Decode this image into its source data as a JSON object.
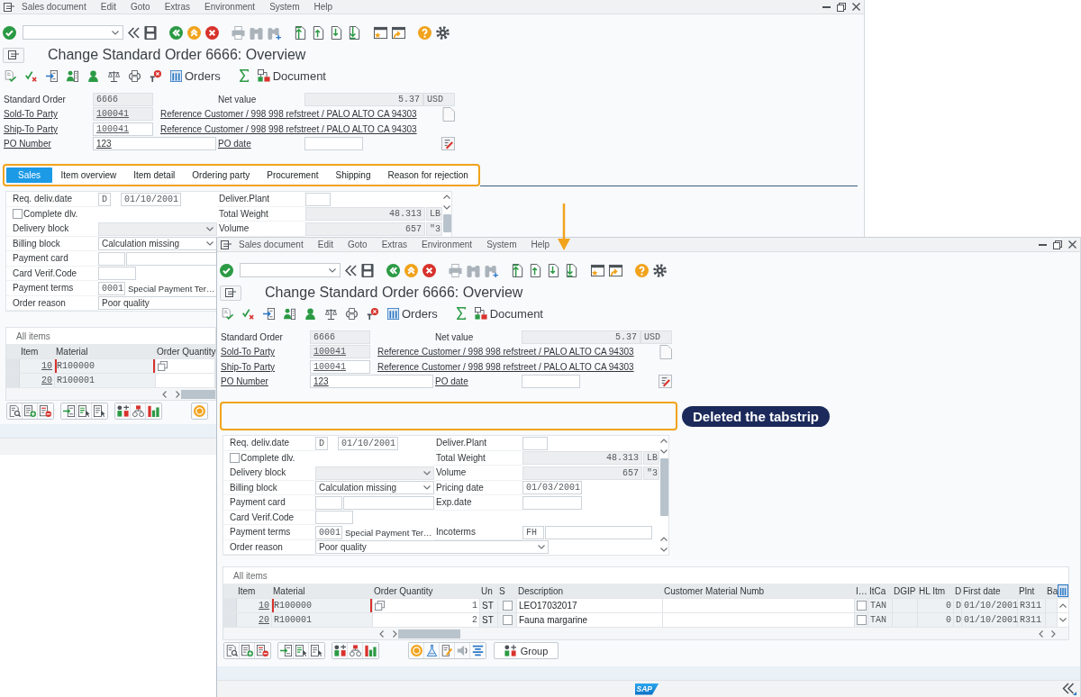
{
  "windows": [
    {
      "menu_bar": [
        "Sales document",
        "Edit",
        "Goto",
        "Extras",
        "Environment",
        "System",
        "Help"
      ],
      "title": "Change Standard Order 6666: Overview",
      "app_toolbar": {
        "orders_button": "Orders",
        "document_button": "Document"
      },
      "header": {
        "standard_order": {
          "label": "Standard Order",
          "link": false,
          "value": "6666",
          "editable": false
        },
        "net_value": {
          "label": "Net value",
          "link": false,
          "value": "5.37",
          "currency": "USD",
          "editable": false
        },
        "sold_to_party": {
          "label": "Sold-To Party",
          "link": true,
          "value": "100041",
          "editable": false,
          "description": "Reference Customer / 998 998 refstreet / PALO ALTO CA 94303"
        },
        "ship_to_party": {
          "label": "Ship-To Party",
          "link": true,
          "value": "100041",
          "editable": true,
          "description": "Reference Customer / 998 998 refstreet / PALO ALTO CA 94303"
        },
        "po_number": {
          "label": "PO Number",
          "link": true,
          "value": "123",
          "editable": true
        },
        "po_date": {
          "label": "PO date",
          "link": true,
          "editable": true
        }
      },
      "tabstrip": {
        "highlighted": true,
        "tabs": [
          {
            "label": "Sales",
            "selected": true
          },
          {
            "label": "Item overview",
            "selected": false
          },
          {
            "label": "Item detail",
            "selected": false
          },
          {
            "label": "Ordering party",
            "selected": false
          },
          {
            "label": "Procurement",
            "selected": false
          },
          {
            "label": "Shipping",
            "selected": false
          },
          {
            "label": "Reason for rejection",
            "selected": false
          }
        ]
      },
      "form": {
        "rows": [
          {
            "left": {
              "kind": "date",
              "label": "Req. deliv.date",
              "date_type": "D",
              "value": "01/10/2001"
            },
            "right": {
              "kind": "field",
              "label": "Deliver.Plant"
            }
          },
          {
            "left": {
              "kind": "checkbox",
              "label": "Complete dlv.",
              "checked": false
            },
            "right": {
              "kind": "quantity",
              "label": "Total Weight",
              "value": "48.313",
              "unit": "LB",
              "editable": false
            }
          },
          {
            "left": {
              "kind": "dropdown",
              "label": "Delivery block",
              "editable": false
            },
            "right": {
              "kind": "quantity",
              "label": "Volume",
              "value": "657",
              "unit": "\"3",
              "editable": false
            }
          },
          {
            "left": {
              "kind": "dropdown",
              "label": "Billing block",
              "value": "Calculation missing",
              "editable": true
            }
          },
          {
            "left": {
              "kind": "split",
              "label": "Payment card"
            }
          },
          {
            "left": {
              "kind": "field",
              "label": "Card Verif.Code"
            }
          },
          {
            "left": {
              "kind": "code",
              "label": "Payment terms",
              "code": "0001",
              "text": "Special Payment Ter…"
            }
          },
          {
            "left": {
              "kind": "textbox",
              "label": "Order reason",
              "value": "Poor quality"
            }
          }
        ]
      },
      "table": {
        "title": "All items",
        "columns": [
          {
            "label": "Item",
            "kind": "hotspot",
            "editable": false
          },
          {
            "label": "Material",
            "kind": "keyfield",
            "editable": false
          },
          {
            "label": "Order Quantity",
            "kind": "quantity",
            "editable": true
          }
        ],
        "rows": [
          {
            "item": "10",
            "material": "R100000",
            "focused": true
          },
          {
            "item": "20",
            "material": "R100001",
            "focused": false
          }
        ]
      }
    },
    {
      "menu_bar": [
        "Sales document",
        "Edit",
        "Goto",
        "Extras",
        "Environment",
        "System",
        "Help"
      ],
      "title": "Change Standard Order 6666: Overview",
      "app_toolbar": {
        "orders_button": "Orders",
        "document_button": "Document"
      },
      "header": {
        "standard_order": {
          "label": "Standard Order",
          "link": false,
          "value": "6666",
          "editable": false
        },
        "net_value": {
          "label": "Net value",
          "link": false,
          "value": "5.37",
          "currency": "USD",
          "editable": false
        },
        "sold_to_party": {
          "label": "Sold-To Party",
          "link": true,
          "value": "100041",
          "editable": false,
          "description": "Reference Customer / 998 998 refstreet / PALO ALTO CA 94303"
        },
        "ship_to_party": {
          "label": "Ship-To Party",
          "link": true,
          "value": "100041",
          "editable": true,
          "description": "Reference Customer / 998 998 refstreet / PALO ALTO CA 94303"
        },
        "po_number": {
          "label": "PO Number",
          "link": true,
          "value": "123",
          "editable": true
        },
        "po_date": {
          "label": "PO date",
          "link": true,
          "editable": true
        }
      },
      "tabstrip": {
        "highlighted": true,
        "callout": "Deleted the tabstrip"
      },
      "form": {
        "rows": [
          {
            "left": {
              "kind": "date",
              "label": "Req. deliv.date",
              "date_type": "D",
              "value": "01/10/2001"
            },
            "right": {
              "kind": "field",
              "label": "Deliver.Plant"
            }
          },
          {
            "left": {
              "kind": "checkbox",
              "label": "Complete dlv.",
              "checked": false
            },
            "right": {
              "kind": "quantity",
              "label": "Total Weight",
              "value": "48.313",
              "unit": "LB",
              "editable": false
            }
          },
          {
            "left": {
              "kind": "dropdown",
              "label": "Delivery block",
              "editable": false
            },
            "right": {
              "kind": "quantity",
              "label": "Volume",
              "value": "657",
              "unit": "\"3",
              "editable": false
            }
          },
          {
            "left": {
              "kind": "dropdown",
              "label": "Billing block",
              "value": "Calculation missing",
              "editable": true
            },
            "right": {
              "kind": "date",
              "label": "Pricing date",
              "value": "01/03/2001"
            }
          },
          {
            "left": {
              "kind": "split",
              "label": "Payment card"
            },
            "right": {
              "kind": "date",
              "label": "Exp.date"
            }
          },
          {
            "left": {
              "kind": "field",
              "label": "Card Verif.Code"
            }
          },
          {
            "left": {
              "kind": "code",
              "label": "Payment terms",
              "code": "0001",
              "text": "Special Payment Ter…"
            },
            "right": {
              "kind": "code",
              "label": "Incoterms",
              "code": "FH"
            }
          },
          {
            "left": {
              "kind": "combobox",
              "label": "Order reason",
              "value": "Poor quality",
              "editable": true
            }
          }
        ]
      },
      "table": {
        "title": "All items",
        "columns": [
          {
            "label": "Item",
            "kind": "hotspot",
            "editable": false
          },
          {
            "label": "Material",
            "kind": "keyfield",
            "editable": false
          },
          {
            "label": "Order Quantity",
            "kind": "quantity",
            "editable": true
          },
          {
            "label": "Un",
            "kind": "unit",
            "editable": false
          },
          {
            "label": "S",
            "kind": "check",
            "editable": false
          },
          {
            "label": "Description",
            "kind": "text",
            "editable": true
          },
          {
            "label": "Customer Material Numb",
            "kind": "text",
            "editable": true
          },
          {
            "label": "I…",
            "kind": "check",
            "editable": false
          },
          {
            "label": "ItCa",
            "kind": "code",
            "editable": false
          },
          {
            "label": "DGIP",
            "kind": "code",
            "editable": false
          },
          {
            "label": "HL Itm",
            "kind": "number",
            "editable": false
          },
          {
            "label": "D",
            "kind": "flag",
            "editable": false
          },
          {
            "label": "First date",
            "kind": "code",
            "editable": false
          },
          {
            "label": "Plnt",
            "kind": "code",
            "editable": false
          },
          {
            "label": "Ba",
            "kind": "code",
            "editable": false
          }
        ],
        "rows": [
          {
            "item": "10",
            "material": "R100000",
            "order_quantity": "1",
            "un": "ST",
            "s": {
              "checked": false
            },
            "description": "LEO17032017",
            "column_8": {
              "checked": false
            },
            "itca": "TAN",
            "hl_itm": "0",
            "d": "D",
            "first_date": "01/10/2001",
            "plnt": "R311",
            "focused": true
          },
          {
            "item": "20",
            "material": "R100001",
            "order_quantity": "2",
            "un": "ST",
            "s": {
              "checked": false
            },
            "description": "Fauna margarine",
            "column_8": {
              "checked": false
            },
            "itca": "TAN",
            "hl_itm": "0",
            "d": "D",
            "first_date": "01/10/2001",
            "plnt": "R311",
            "focused": false
          }
        ]
      },
      "table_toolbar": {
        "group_button": "Group"
      },
      "status_bar": {
        "logo": "SAP"
      }
    }
  ]
}
